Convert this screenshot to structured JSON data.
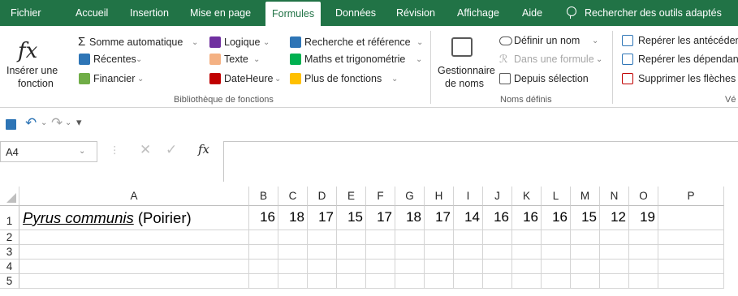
{
  "tabs": [
    "Fichier",
    "Accueil",
    "Insertion",
    "Mise en page",
    "Formules",
    "Données",
    "Révision",
    "Affichage",
    "Aide"
  ],
  "active_tab": "Formules",
  "tell_me": "Rechercher des outils adaptés",
  "ribbon": {
    "insert_function": [
      "Insérer une",
      "fonction"
    ],
    "library": {
      "autosum": "Somme automatique",
      "recent": "Récentes",
      "financial": "Financier",
      "logical": "Logique",
      "text": "Texte",
      "datetime": "DateHeure",
      "lookup": "Recherche et référence",
      "math": "Maths et trigonométrie",
      "more": "Plus de fonctions",
      "group_label": "Bibliothèque de fonctions"
    },
    "names": {
      "manager": [
        "Gestionnaire",
        "de noms"
      ],
      "define": "Définir un nom",
      "use_in_formula": "Dans une formule",
      "create_from_selection": "Depuis sélection",
      "group_label": "Noms définis"
    },
    "audit": {
      "precedents": "Repérer les antécédents",
      "dependents": "Repérer les dépendants",
      "remove_arrows": "Supprimer les flèches",
      "group_label": "Vé"
    }
  },
  "formula_bar": {
    "name_box": "A4",
    "fx": "fx",
    "value": ""
  },
  "columns": [
    "A",
    "B",
    "C",
    "D",
    "E",
    "F",
    "G",
    "H",
    "I",
    "J",
    "K",
    "L",
    "M",
    "N",
    "O",
    "P"
  ],
  "rows": [
    "1",
    "2",
    "3",
    "4",
    "5"
  ],
  "row1": {
    "species": "Pyrus communis",
    "common": "(Poirier)",
    "values": [
      16,
      18,
      17,
      15,
      17,
      18,
      17,
      14,
      16,
      16,
      16,
      15,
      12,
      19
    ]
  },
  "colors": {
    "excel_green": "#217346",
    "gridline": "#d4d4d4"
  }
}
